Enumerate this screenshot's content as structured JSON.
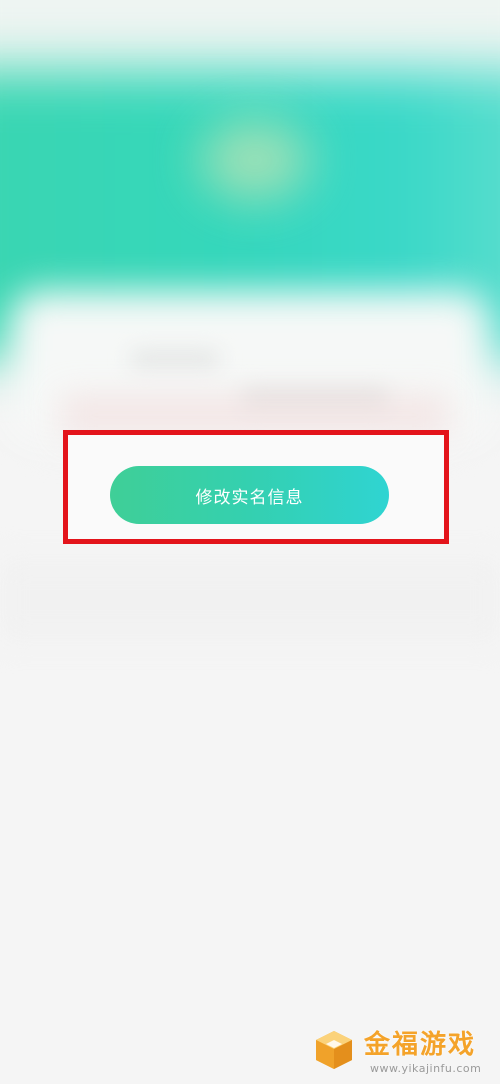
{
  "main": {
    "action_button_label": "修改实名信息"
  },
  "watermark": {
    "title": "金福游戏",
    "url": "www.yikajinfu.com",
    "logo_icon": "gold-cube-icon"
  },
  "colors": {
    "header_green": "#35d7bb",
    "button_start": "#3fcf97",
    "button_end": "#2fd4d2",
    "highlight_red": "#e3141b",
    "watermark_orange": "#f4a32a"
  }
}
